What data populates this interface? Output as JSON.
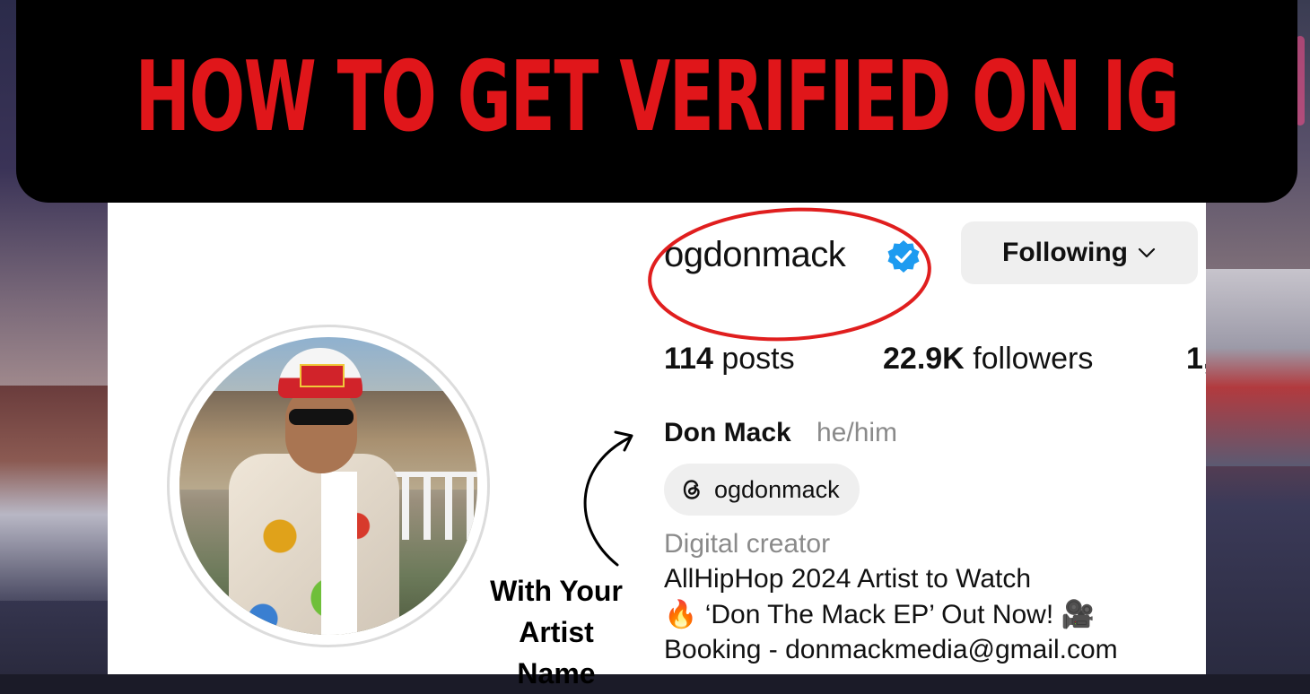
{
  "banner": {
    "title": "HOW TO GET VERIFIED ON IG"
  },
  "profile": {
    "username": "ogdonmack",
    "follow_button": "Following",
    "stats": {
      "posts_count": "114",
      "posts_label": "posts",
      "followers_count": "22.9K",
      "followers_label": "followers",
      "following_partial": "1,"
    },
    "full_name": "Don Mack",
    "pronouns": "he/him",
    "threads_handle": "ogdonmack",
    "category": "Digital creator",
    "bio": [
      "AllHipHop 2024 Artist to Watch",
      "🔥 ‘Don The Mack EP’ Out Now! 🎥",
      "Booking - donmackmedia@gmail.com"
    ]
  },
  "annotation": {
    "line1": "With Your",
    "line2": "Artist",
    "line3": "Name"
  },
  "colors": {
    "banner_text": "#e0161a",
    "verified_badge": "#1d9bf0",
    "highlight_circle": "#e01e1e"
  },
  "icons": [
    "verified-badge-icon",
    "chevron-down-icon",
    "threads-icon",
    "curved-arrow-icon"
  ]
}
